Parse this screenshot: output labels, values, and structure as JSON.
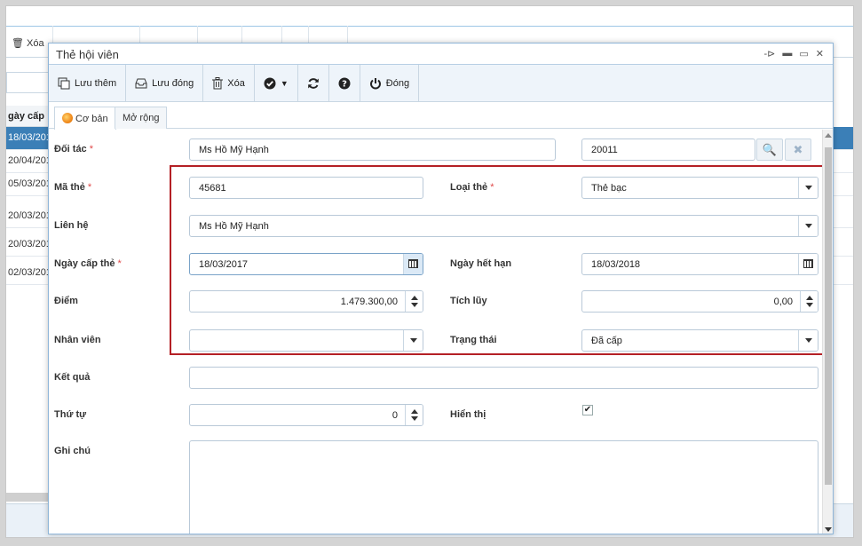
{
  "background": {
    "toolbar_delete_label": "Xóa",
    "grid_header": "gày cấp",
    "rows": [
      "18/03/201",
      "20/04/201",
      "05/03/201",
      "20/03/201",
      "20/03/201",
      "02/03/201"
    ]
  },
  "dialog": {
    "title": "Thẻ hội viên",
    "window_controls": [
      "pin-icon",
      "minimize-icon",
      "maximize-icon",
      "close-icon"
    ]
  },
  "toolbar": {
    "save_new_label": "Lưu thêm",
    "save_close_label": "Lưu đóng",
    "delete_label": "Xóa",
    "close_label": "Đóng"
  },
  "tabs": {
    "basic": "Cơ bản",
    "extended": "Mở rộng"
  },
  "form": {
    "partner": {
      "label": "Đối tác",
      "value": "Ms Hồ Mỹ Hạnh",
      "code": "20011"
    },
    "card_no": {
      "label": "Mã thẻ",
      "value": "45681"
    },
    "card_type": {
      "label": "Loại thẻ",
      "value": "Thẻ bạc"
    },
    "contact": {
      "label": "Liên hệ",
      "value": "Ms Hồ Mỹ Hạnh"
    },
    "issue_date": {
      "label": "Ngày cấp thẻ",
      "value": "18/03/2017"
    },
    "expiry_date": {
      "label": "Ngày hết hạn",
      "value": "18/03/2018"
    },
    "points": {
      "label": "Điểm",
      "value": "1.479.300,00"
    },
    "accumulated": {
      "label": "Tích lũy",
      "value": "0,00"
    },
    "employee": {
      "label": "Nhân viên",
      "value": ""
    },
    "status": {
      "label": "Trạng thái",
      "value": "Đã cấp"
    },
    "result": {
      "label": "Kết quả",
      "value": ""
    },
    "order": {
      "label": "Thứ tự",
      "value": "0"
    },
    "visible": {
      "label": "Hiển thị",
      "checked": true
    },
    "note": {
      "label": "Ghi chú",
      "value": ""
    },
    "required_mark": "*"
  },
  "colors": {
    "accent": "#3b7fb7",
    "highlight_border": "#b42025",
    "required": "#e04848"
  }
}
